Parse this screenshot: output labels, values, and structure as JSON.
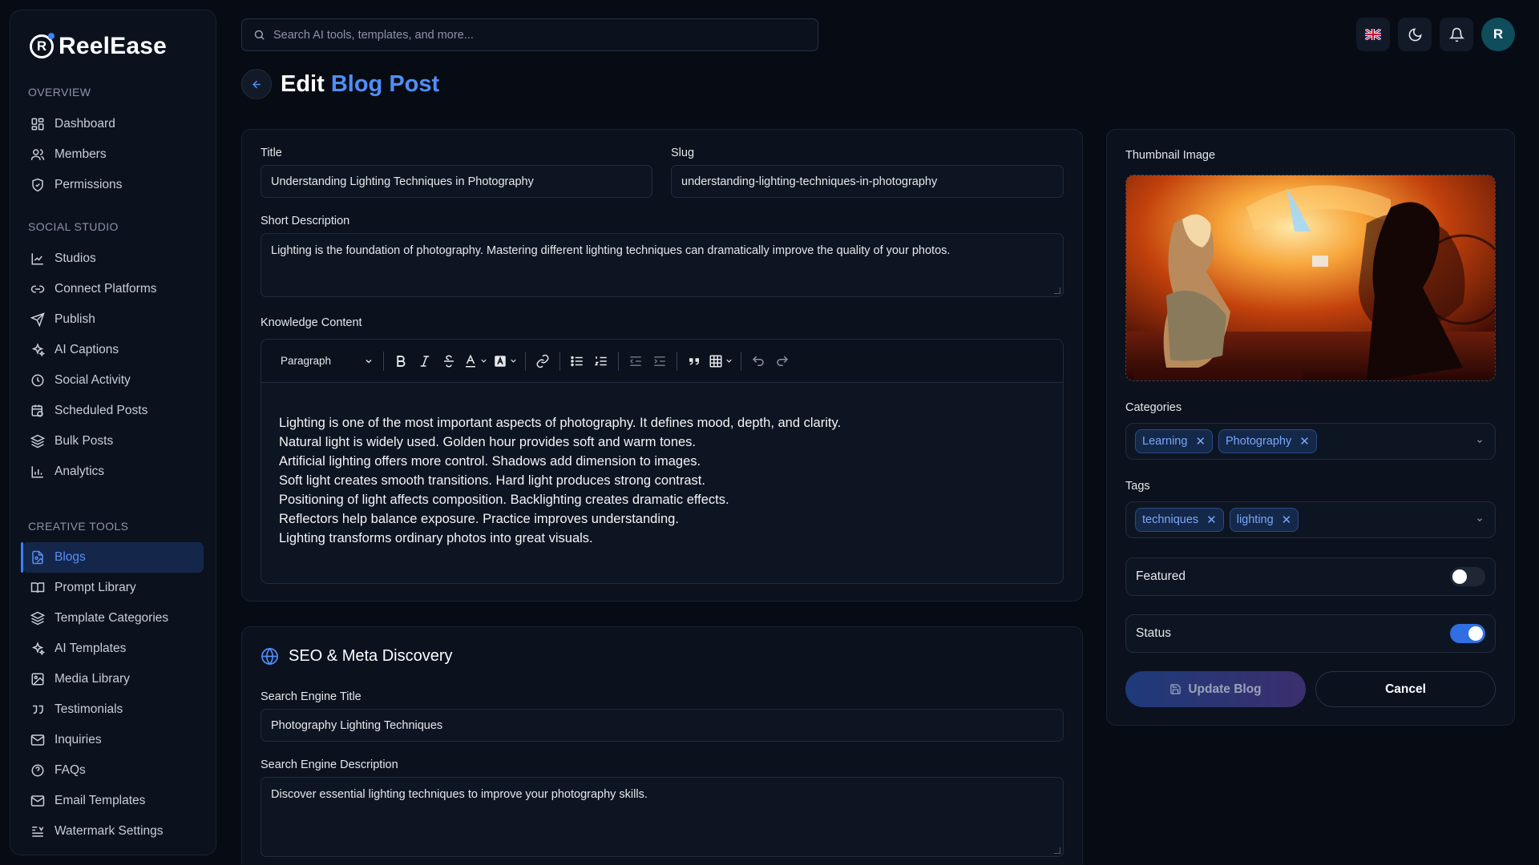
{
  "brand": {
    "name": "ReelEase",
    "mark": "R"
  },
  "sidebar": {
    "sections": [
      {
        "heading": "OVERVIEW",
        "items": [
          {
            "label": "Dashboard",
            "icon": "grid-icon"
          },
          {
            "label": "Members",
            "icon": "users-icon"
          },
          {
            "label": "Permissions",
            "icon": "shield-icon"
          }
        ]
      },
      {
        "heading": "SOCIAL STUDIO",
        "items": [
          {
            "label": "Studios",
            "icon": "chart-icon"
          },
          {
            "label": "Connect Platforms",
            "icon": "link-icon"
          },
          {
            "label": "Publish",
            "icon": "send-icon"
          },
          {
            "label": "AI Captions",
            "icon": "sparkles-icon"
          },
          {
            "label": "Social Activity",
            "icon": "clock-icon"
          },
          {
            "label": "Scheduled Posts",
            "icon": "calendar-clock-icon"
          },
          {
            "label": "Bulk Posts",
            "icon": "layers-icon"
          },
          {
            "label": "Analytics",
            "icon": "bar-chart-icon"
          }
        ]
      },
      {
        "heading": "CREATIVE TOOLS",
        "items": [
          {
            "label": "Blogs",
            "icon": "file-image-icon",
            "active": true
          },
          {
            "label": "Prompt Library",
            "icon": "book-open-icon"
          },
          {
            "label": "Template Categories",
            "icon": "layers-icon"
          },
          {
            "label": "AI Templates",
            "icon": "sparkles-icon"
          },
          {
            "label": "Media Library",
            "icon": "image-icon"
          },
          {
            "label": "Testimonials",
            "icon": "quote-icon"
          },
          {
            "label": "Inquiries",
            "icon": "mail-icon"
          },
          {
            "label": "FAQs",
            "icon": "help-circle-icon"
          },
          {
            "label": "Email Templates",
            "icon": "mail-icon"
          },
          {
            "label": "Watermark Settings",
            "icon": "text-align-icon"
          }
        ]
      }
    ]
  },
  "header": {
    "search_placeholder": "Search AI tools, templates, and more...",
    "avatar_initial": "R"
  },
  "page": {
    "title_plain": "Edit",
    "title_accent": "Blog Post"
  },
  "form": {
    "title_label": "Title",
    "title_value": "Understanding Lighting Techniques in Photography",
    "slug_label": "Slug",
    "slug_value": "understanding-lighting-techniques-in-photography",
    "short_desc_label": "Short Description",
    "short_desc_value": "Lighting is the foundation of photography. Mastering different lighting techniques can dramatically improve the quality of your photos.",
    "content_label": "Knowledge Content",
    "paragraph_select": "Paragraph",
    "content_lines": [
      "Lighting is one of the most important aspects of photography. It defines mood, depth, and clarity.",
      "Natural light is widely used. Golden hour provides soft and warm tones.",
      "Artificial lighting offers more control. Shadows add dimension to images.",
      "Soft light creates smooth transitions. Hard light produces strong contrast.",
      "Positioning of light affects composition. Backlighting creates dramatic effects.",
      "Reflectors help balance exposure. Practice improves understanding.",
      "Lighting transforms ordinary photos into great visuals."
    ]
  },
  "seo": {
    "heading": "SEO & Meta Discovery",
    "engine_title_label": "Search Engine Title",
    "engine_title_value": "Photography Lighting Techniques",
    "engine_desc_label": "Search Engine Description",
    "engine_desc_value": "Discover essential lighting techniques to improve your photography skills."
  },
  "side": {
    "thumbnail_label": "Thumbnail Image",
    "categories_label": "Categories",
    "categories": [
      "Learning",
      "Photography"
    ],
    "tags_label": "Tags",
    "tags": [
      "techniques",
      "lighting"
    ],
    "featured_label": "Featured",
    "featured_on": false,
    "status_label": "Status",
    "status_on": true,
    "update_button": "Update Blog",
    "cancel_button": "Cancel"
  },
  "colors": {
    "accent": "#4f8ef7",
    "background": "#070b14",
    "panel": "#0b111d"
  }
}
